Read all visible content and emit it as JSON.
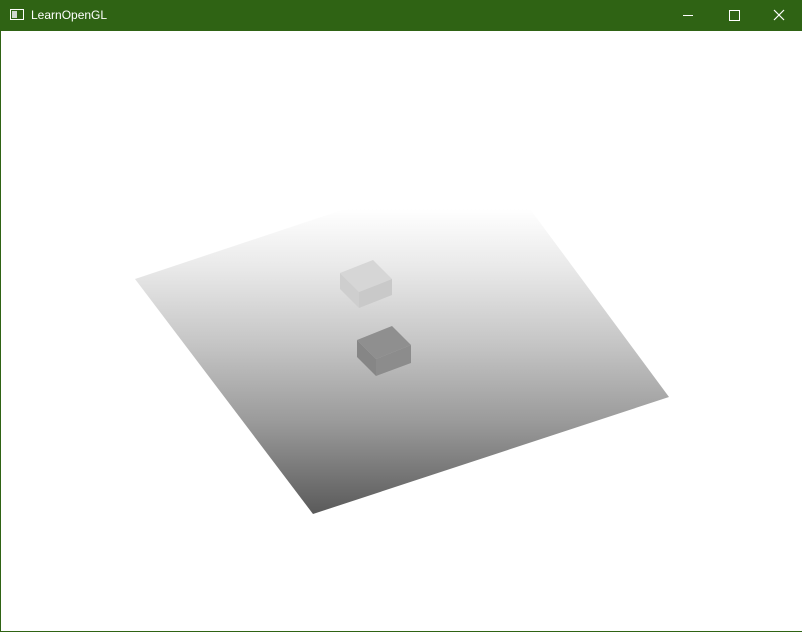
{
  "window": {
    "title": "LearnOpenGL",
    "titlebar_color": "#2f6314",
    "icons": {
      "app": "app-window-icon",
      "minimize": "minimize-icon",
      "maximize": "maximize-icon",
      "close": "close-icon"
    }
  },
  "scene": {
    "description_type": "depth-buffer-visualization",
    "background_color": "#ffffff",
    "plane_gradient": [
      "#ffffff",
      "#e8e8e8",
      "#c4c4c4",
      "#9a9a9a",
      "#5a5a5a"
    ],
    "cube_near_color": "#8f8f8f",
    "cube_far_color": "#d2d2d2"
  }
}
